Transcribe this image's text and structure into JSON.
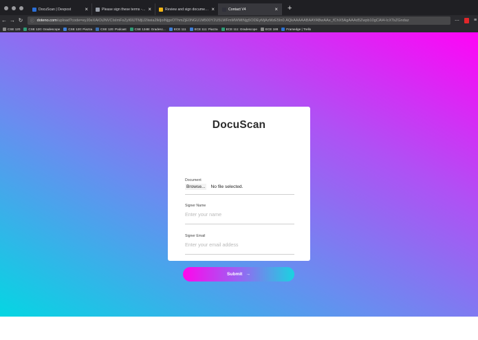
{
  "browser": {
    "tabs": [
      {
        "title": "DocuScan | Devpost",
        "color": "#2b6fd8",
        "active": false
      },
      {
        "title": "Please sign these terms - ann",
        "color": "#9aa0aa",
        "active": false
      },
      {
        "title": "Review and sign document(s)",
        "color": "#f3b515",
        "active": false
      },
      {
        "title": "Contact V4",
        "color": "#30303a",
        "active": true
      }
    ],
    "url_domain": "doteno.com",
    "url_rest": "/upload?code=eyJ0eXAiOiJNVCIsImFsZyI6IlJTMjU2Iiwia2lkIjoiNjgxOThmZjE0NGU1M500Y2U5LWFmMWMtNjg5ODEyMjAzMzE5In0.AQkAAAAABAAYABwAAe_fChX5AgAAAd5Zwpb10gCAI4-IcXTsZGndaz",
    "bookmarks": [
      {
        "label": "CSE 120",
        "color": "#8a8a8a"
      },
      {
        "label": "CSE 120: Gradescope",
        "color": "#2f9c76"
      },
      {
        "label": "CSE 120: Piazza",
        "color": "#3f7fd9"
      },
      {
        "label": "CSE 120: Podcast",
        "color": "#3c6fb0"
      },
      {
        "label": "CSE 134B: Gradesc...",
        "color": "#2f9c76"
      },
      {
        "label": "ECE 111",
        "color": "#3f7fd9"
      },
      {
        "label": "ECE 111: Piazza",
        "color": "#3f7fd9"
      },
      {
        "label": "ECE 111: Gradescope",
        "color": "#2f9c76"
      },
      {
        "label": "ECE 188",
        "color": "#8a8a8a"
      },
      {
        "label": "Framedge | Trello",
        "color": "#2e72d2"
      }
    ]
  },
  "form": {
    "title": "DocuScan",
    "document_label": "Document",
    "browse_label": "Browse...",
    "file_status": "No file selected.",
    "signer_name_label": "Signer Name",
    "signer_name_placeholder": "Enter your name",
    "signer_email_label": "Signer Email",
    "signer_email_placeholder": "Enter your email addess",
    "submit_label": "Submit",
    "submit_arrow": "→"
  }
}
